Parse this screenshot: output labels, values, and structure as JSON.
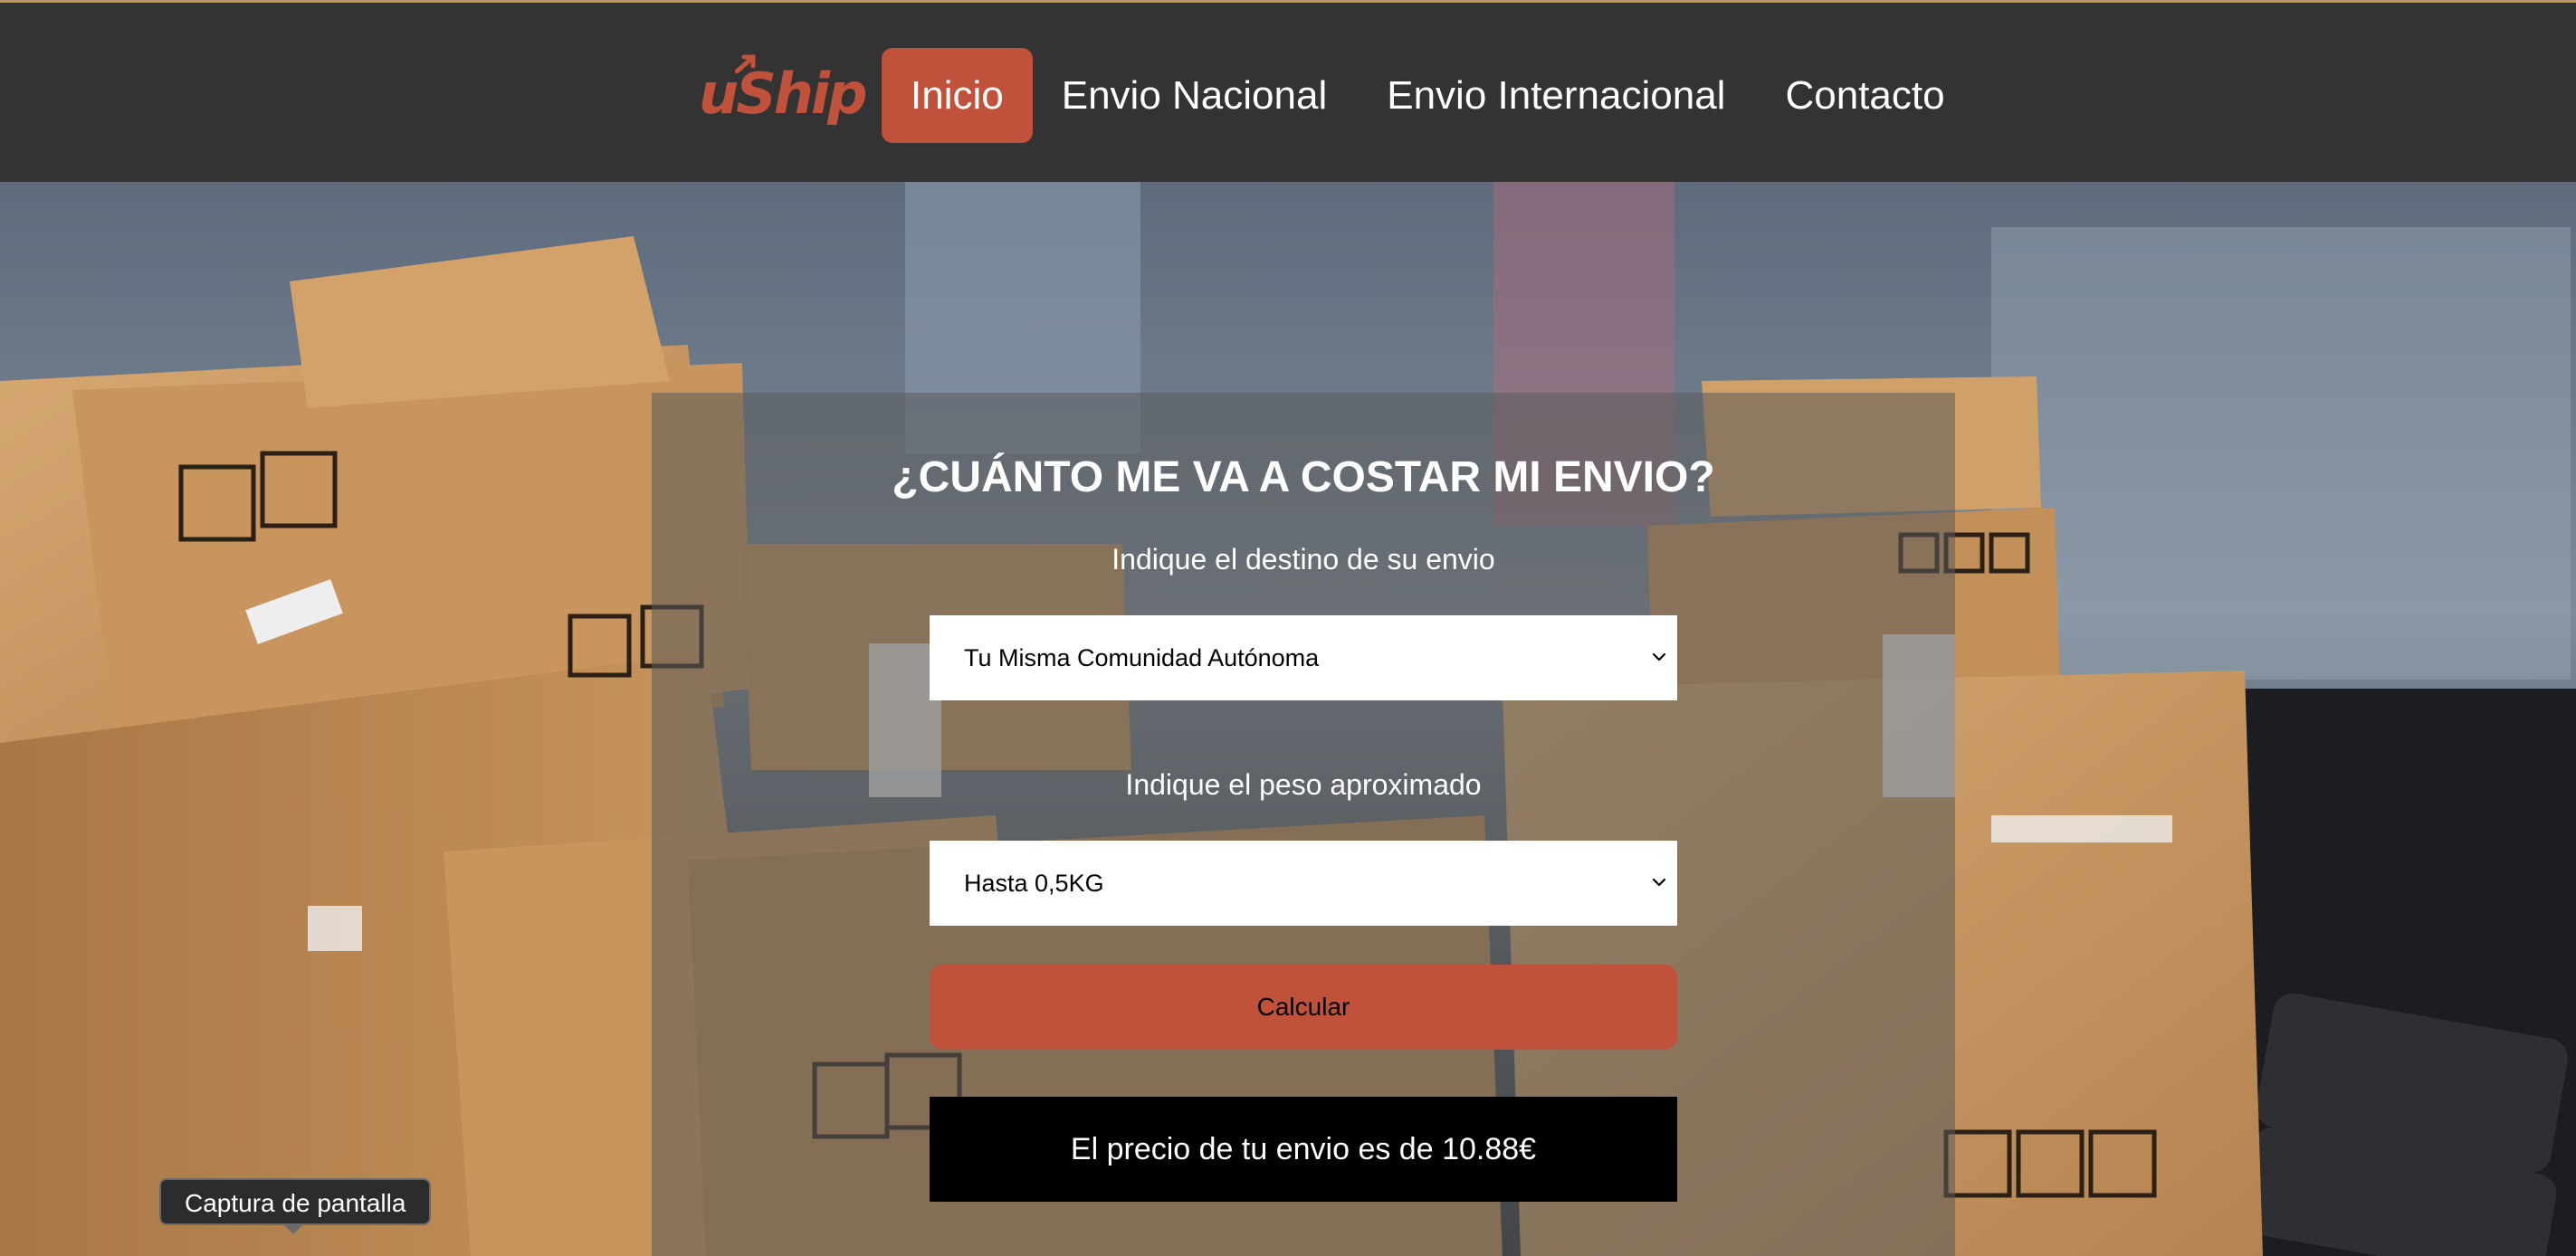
{
  "nav": {
    "logo_text": "uShip",
    "items": [
      {
        "label": "Inicio",
        "active": true
      },
      {
        "label": "Envio Nacional",
        "active": false
      },
      {
        "label": "Envio Internacional",
        "active": false
      },
      {
        "label": "Contacto",
        "active": false
      }
    ]
  },
  "form": {
    "title": "¿CUÁNTO ME VA A COSTAR MI ENVIO?",
    "destination_label": "Indique el destino de su envio",
    "destination_value": "Tu Misma Comunidad Autónoma",
    "weight_label": "Indique el peso aproximado",
    "weight_value": "Hasta 0,5KG",
    "calculate_label": "Calcular",
    "result_text": "El precio de tu envio es de 10.88€"
  },
  "tooltip": {
    "text": "Captura de pantalla"
  },
  "colors": {
    "accent": "#c0513a",
    "navbar": "#333333",
    "panel_overlay": "rgba(90,90,90,0.55)",
    "result_bg": "#000000"
  }
}
